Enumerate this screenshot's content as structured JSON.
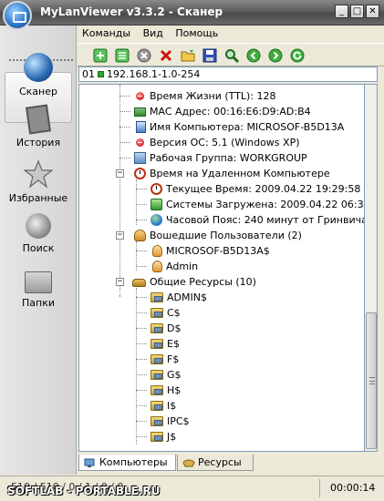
{
  "window": {
    "title": "MyLanViewer v3.3.2 - Сканер",
    "minimize_label": "_",
    "maximize_label": "□",
    "close_label": "✕"
  },
  "menu": [
    "Команды",
    "Вид",
    "Помощь"
  ],
  "toolbar": {
    "icons": [
      "add-green-icon",
      "add-green-icon-2",
      "stop-icon",
      "delete-icon",
      "open-folder-icon",
      "save-icon",
      "search-icon",
      "back-icon",
      "forward-icon",
      "refresh-icon"
    ],
    "colors": {
      "green": "#2e9e2e",
      "red": "#cc1111",
      "blue": "#1f4fb0"
    }
  },
  "sidebar": {
    "items": [
      {
        "label": "Сканер",
        "icon": "globe-icon",
        "active": true
      },
      {
        "label": "История",
        "icon": "history-icon"
      },
      {
        "label": "Избранные",
        "icon": "star-icon"
      },
      {
        "label": "Поиск",
        "icon": "search-icon"
      },
      {
        "label": "Папки",
        "icon": "folders-icon"
      }
    ]
  },
  "address": {
    "prefix": "01",
    "value": "192.168.1-1.0-254"
  },
  "tree": {
    "rows": [
      {
        "text": "Время Жизни (TTL): 128",
        "icon": "info-red-icon"
      },
      {
        "text": "MAC Адрес: 00:16:E6:D9:AD:B4",
        "icon": "network-card-icon"
      },
      {
        "text": "Имя Компьютера: MICROSOF-B5D13A",
        "icon": "computer-icon"
      },
      {
        "text": "Версия ОС: 5.1 (Windows XP)",
        "icon": "info-red-icon"
      },
      {
        "text": "Рабочая Группа: WORKGROUP",
        "icon": "workgroup-icon"
      },
      {
        "text": "Время на Удаленном Компьютере",
        "icon": "clock-icon"
      },
      {
        "text": "Текущее Время: 2009.04.22  19:29:58",
        "icon": "clock-icon"
      },
      {
        "text": "Системы Загружена: 2009.04.22  06:32:23",
        "icon": "green-box-icon"
      },
      {
        "text": "Часовой Пояс: 240 минут от Гринвича",
        "icon": "globe-icon"
      },
      {
        "text": "Вошедшие Пользователи (2)",
        "icon": "users-icon"
      },
      {
        "text": "MICROSOF-B5D13A$",
        "icon": "user-icon"
      },
      {
        "text": "Admin",
        "icon": "user-icon"
      },
      {
        "text": "Общие Ресурсы (10)",
        "icon": "share-icon"
      },
      {
        "text": "ADMIN$",
        "icon": "shared-folder-icon"
      },
      {
        "text": "C$",
        "icon": "shared-folder-icon"
      },
      {
        "text": "D$",
        "icon": "shared-folder-icon"
      },
      {
        "text": "E$",
        "icon": "shared-folder-icon"
      },
      {
        "text": "F$",
        "icon": "shared-folder-icon"
      },
      {
        "text": "G$",
        "icon": "shared-folder-icon"
      },
      {
        "text": "H$",
        "icon": "shared-folder-icon"
      },
      {
        "text": "I$",
        "icon": "shared-folder-icon"
      },
      {
        "text": "IPC$",
        "icon": "shared-folder-icon"
      },
      {
        "text": "J$",
        "icon": "shared-folder-icon"
      }
    ]
  },
  "tabs": [
    {
      "label": "Компьютеры",
      "active": true
    },
    {
      "label": "Ресурсы",
      "active": false
    }
  ],
  "status": {
    "left": "510 / 510 / 0 / 1 / 0 / 0",
    "watermark": "SOFTLAB - PORTABLE.RU",
    "time": "00:00:14"
  }
}
